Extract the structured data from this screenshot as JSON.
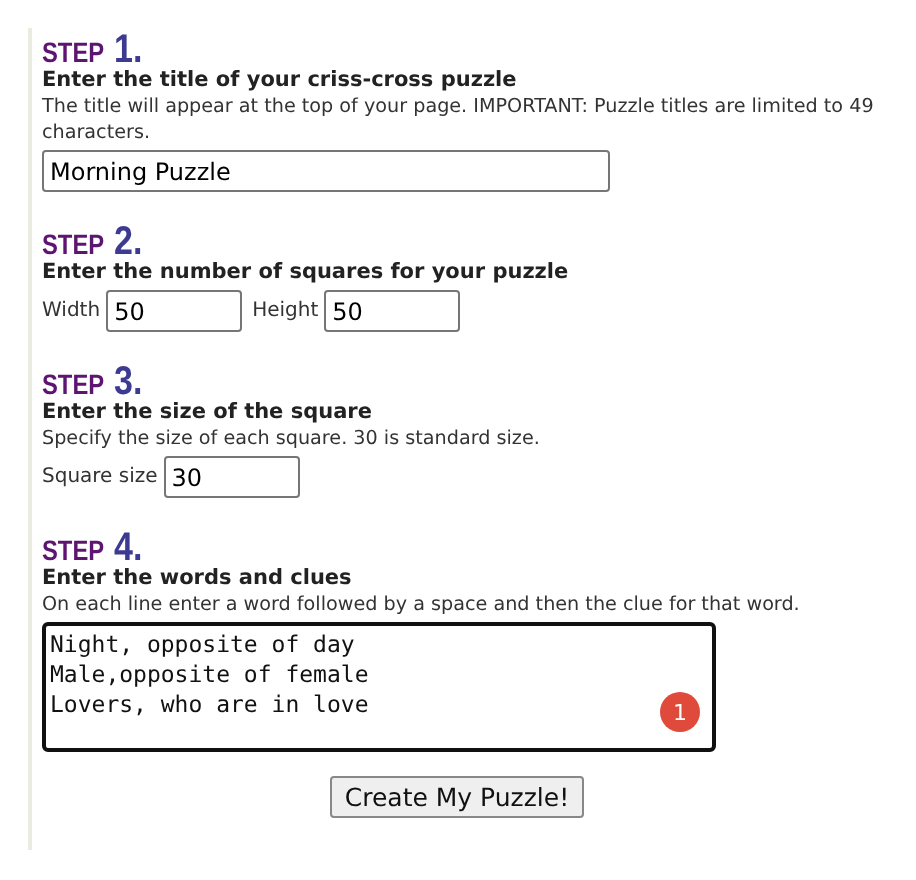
{
  "steps": [
    {
      "label": "STEP",
      "number": "1.",
      "title": "Enter the title of your criss-cross puzzle",
      "description": "The title will appear at the top of your page. IMPORTANT: Puzzle titles are limited to 49 characters.",
      "fields": [
        {
          "value": "Morning Puzzle",
          "kind": "wide"
        }
      ]
    },
    {
      "label": "STEP",
      "number": "2.",
      "title": "Enter the number of squares for your puzzle",
      "fields": [
        {
          "label": "Width",
          "value": "50",
          "kind": "small"
        },
        {
          "label": "Height",
          "value": "50",
          "kind": "small"
        }
      ]
    },
    {
      "label": "STEP",
      "number": "3.",
      "title": "Enter the size of the square",
      "description": "Specify the size of each square. 30 is standard size.",
      "fields": [
        {
          "label": "Square size",
          "value": "30",
          "kind": "small"
        }
      ]
    },
    {
      "label": "STEP",
      "number": "4.",
      "title": "Enter the words and clues",
      "description": "On each line enter a word followed by a space and then the clue for that word.",
      "textarea": {
        "lines": [
          "Night, opposite of day",
          "Male,opposite of female",
          "Lovers, who are in love"
        ],
        "badge": "1"
      }
    }
  ],
  "submit": "Create My Puzzle!"
}
